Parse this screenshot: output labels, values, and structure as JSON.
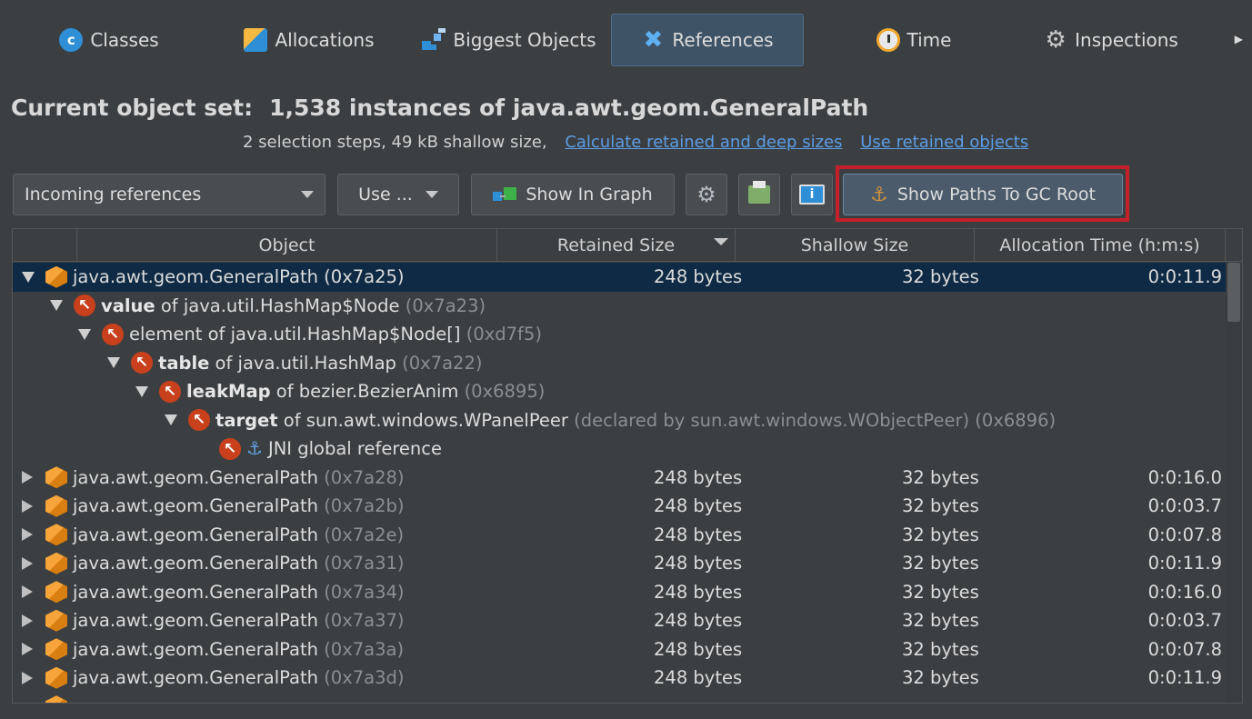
{
  "tabs": [
    {
      "label": "Classes",
      "icon": "classes-icon",
      "active": false
    },
    {
      "label": "Allocations",
      "icon": "allocations-icon",
      "active": false
    },
    {
      "label": "Biggest Objects",
      "icon": "biggest-objects-icon",
      "active": false
    },
    {
      "label": "References",
      "icon": "references-icon",
      "active": true
    },
    {
      "label": "Time",
      "icon": "time-icon",
      "active": false
    },
    {
      "label": "Inspections",
      "icon": "inspections-icon",
      "active": false
    }
  ],
  "header": {
    "label": "Current object set:",
    "value": "1,538 instances of java.awt.geom.GeneralPath",
    "details": "2 selection steps, 49 kB shallow size,",
    "link_calc": "Calculate retained and deep sizes",
    "link_use": "Use retained objects"
  },
  "toolbar": {
    "dropdown_value": "Incoming references",
    "use_label": "Use ...",
    "show_graph_label": "Show In Graph",
    "gc_label": "Show Paths To GC Root"
  },
  "table": {
    "columns": [
      "Object",
      "Retained Size",
      "Shallow Size",
      "Allocation Time (h:m:s)"
    ],
    "selected_row": {
      "name": "java.awt.geom.GeneralPath (0x7a25)",
      "retained": "248 bytes",
      "shallow": "32 bytes",
      "time": "0:0:11.9"
    },
    "path": [
      {
        "field": "value",
        "of": " of java.util.HashMap$Node ",
        "id": "(0x7a23)",
        "bold": true
      },
      {
        "field": "element",
        "of": " of java.util.HashMap$Node[] ",
        "id": "(0xd7f5)",
        "bold": false
      },
      {
        "field": "table",
        "of": " of java.util.HashMap ",
        "id": "(0x7a22)",
        "bold": true
      },
      {
        "field": "leakMap",
        "of": " of bezier.BezierAnim ",
        "id": "(0x6895)",
        "bold": true
      },
      {
        "field": "target",
        "of": " of sun.awt.windows.WPanelPeer ",
        "id": "(declared by sun.awt.windows.WObjectPeer) (0x6896)",
        "bold": true
      }
    ],
    "root": "JNI global reference",
    "rows": [
      {
        "name": "java.awt.geom.GeneralPath",
        "id": "(0x7a28)",
        "retained": "248 bytes",
        "shallow": "32 bytes",
        "time": "0:0:16.0"
      },
      {
        "name": "java.awt.geom.GeneralPath",
        "id": "(0x7a2b)",
        "retained": "248 bytes",
        "shallow": "32 bytes",
        "time": "0:0:03.7"
      },
      {
        "name": "java.awt.geom.GeneralPath",
        "id": "(0x7a2e)",
        "retained": "248 bytes",
        "shallow": "32 bytes",
        "time": "0:0:07.8"
      },
      {
        "name": "java.awt.geom.GeneralPath",
        "id": "(0x7a31)",
        "retained": "248 bytes",
        "shallow": "32 bytes",
        "time": "0:0:11.9"
      },
      {
        "name": "java.awt.geom.GeneralPath",
        "id": "(0x7a34)",
        "retained": "248 bytes",
        "shallow": "32 bytes",
        "time": "0:0:16.0"
      },
      {
        "name": "java.awt.geom.GeneralPath",
        "id": "(0x7a37)",
        "retained": "248 bytes",
        "shallow": "32 bytes",
        "time": "0:0:03.7"
      },
      {
        "name": "java.awt.geom.GeneralPath",
        "id": "(0x7a3a)",
        "retained": "248 bytes",
        "shallow": "32 bytes",
        "time": "0:0:07.8"
      },
      {
        "name": "java.awt.geom.GeneralPath",
        "id": "(0x7a3d)",
        "retained": "248 bytes",
        "shallow": "32 bytes",
        "time": "0:0:11.9"
      }
    ]
  },
  "colors": {
    "background": "#3c3f41",
    "selection": "#0f2a44",
    "link": "#5c9ce6",
    "highlight": "#c4202a"
  }
}
